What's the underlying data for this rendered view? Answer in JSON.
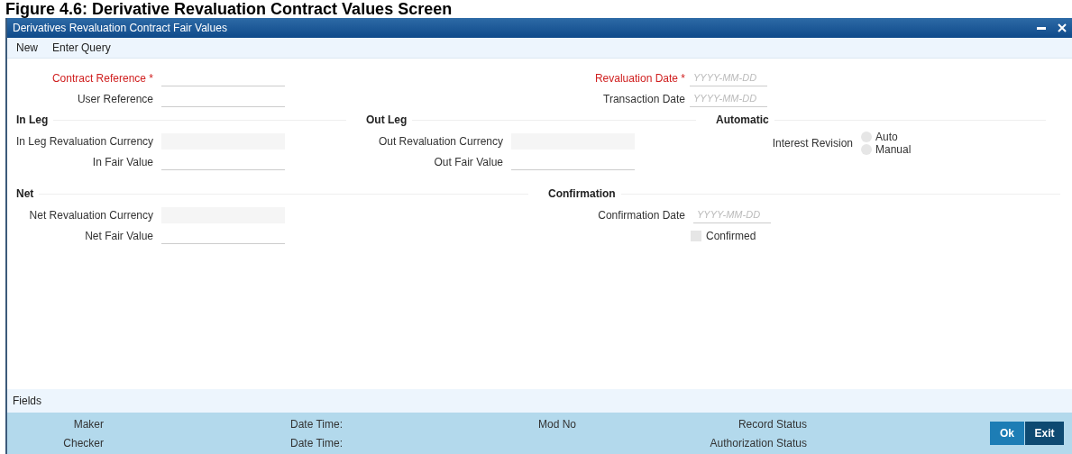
{
  "caption": "Figure 4.6: Derivative Revaluation Contract Values Screen",
  "window": {
    "title": "Derivatives Revaluation Contract Fair Values"
  },
  "toolbar": [
    "New",
    "Enter Query"
  ],
  "header_fields": {
    "left": [
      {
        "kind": "text",
        "label": "Contract Reference *",
        "required": true
      },
      {
        "kind": "text",
        "label": "User Reference",
        "required": false
      }
    ],
    "right": [
      {
        "kind": "date",
        "label": "Revaluation Date *",
        "required": true,
        "placeholder": "YYYY-MM-DD"
      },
      {
        "kind": "date",
        "label": "Transaction Date",
        "required": false,
        "placeholder": "YYYY-MM-DD"
      }
    ]
  },
  "section_rows": [
    [
      {
        "title": "In Leg",
        "fields": [
          {
            "kind": "readonly",
            "label": "In Leg Revaluation Currency"
          },
          {
            "kind": "text",
            "label": "In Fair Value"
          }
        ]
      },
      {
        "title": "Out Leg",
        "fields": [
          {
            "kind": "readonly",
            "label": "Out Revaluation Currency"
          },
          {
            "kind": "text",
            "label": "Out Fair Value"
          }
        ]
      },
      {
        "title": "Automatic",
        "fields": [
          {
            "kind": "radio",
            "label": "Interest Revision",
            "options": [
              {
                "label": "Auto",
                "selected": false
              },
              {
                "label": "Manual",
                "selected": false
              }
            ]
          }
        ]
      }
    ],
    [
      {
        "title": "Net",
        "fields": [
          {
            "kind": "readonly",
            "label": "Net Revaluation Currency"
          },
          {
            "kind": "text",
            "label": "Net Fair Value"
          }
        ]
      },
      {
        "title": "Confirmation",
        "fields": [
          {
            "kind": "date",
            "label": "Confirmation Date",
            "placeholder": "YYYY-MM-DD"
          },
          {
            "kind": "checkbox",
            "label": "Confirmed",
            "checked": false
          }
        ]
      }
    ]
  ],
  "fields_bar": "Fields",
  "audit": {
    "maker": "Maker",
    "maker_date_time": "Date Time:",
    "mod_no": "Mod No",
    "record_status": "Record Status",
    "checker": "Checker",
    "checker_date_time": "Date Time:",
    "authorization_status": "Authorization Status"
  },
  "buttons": [
    {
      "label": "Ok",
      "kind": "primary"
    },
    {
      "label": "Exit",
      "kind": "secondary"
    }
  ]
}
